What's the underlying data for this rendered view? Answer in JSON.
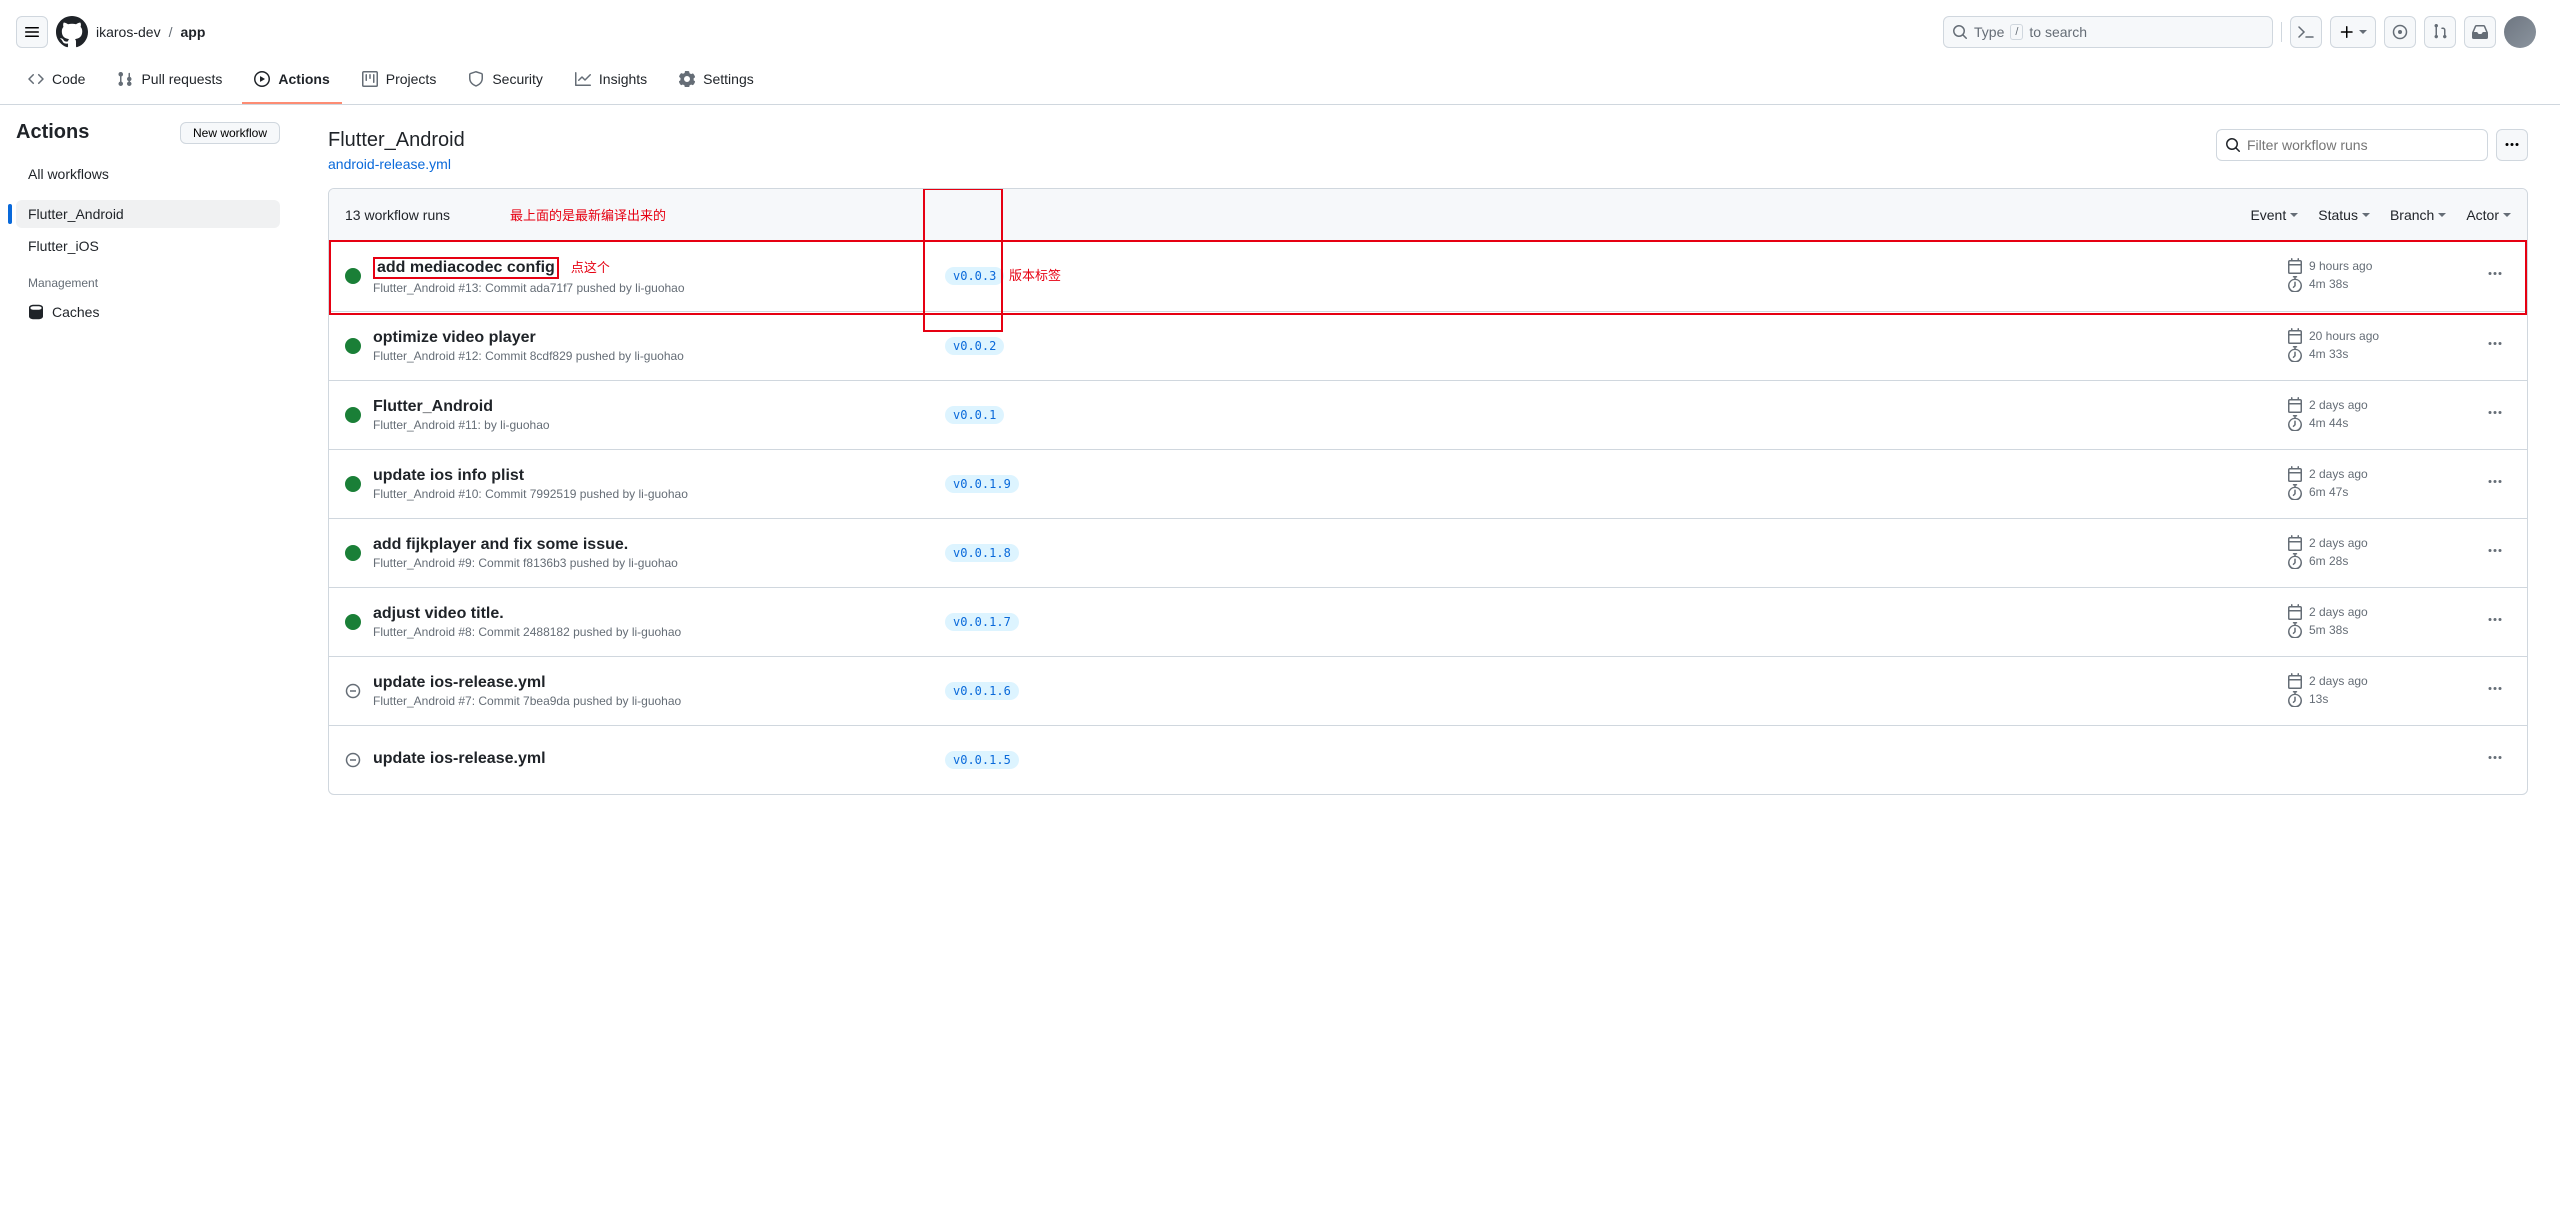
{
  "header": {
    "owner": "ikaros-dev",
    "repo": "app",
    "search_hint_pre": "Type",
    "search_key": "/",
    "search_hint_post": "to search"
  },
  "nav": {
    "code": "Code",
    "pulls": "Pull requests",
    "actions": "Actions",
    "projects": "Projects",
    "security": "Security",
    "insights": "Insights",
    "settings": "Settings"
  },
  "sidebar": {
    "title": "Actions",
    "new_workflow": "New workflow",
    "all": "All workflows",
    "wf1": "Flutter_Android",
    "wf2": "Flutter_iOS",
    "management": "Management",
    "caches": "Caches"
  },
  "content": {
    "title": "Flutter_Android",
    "file": "android-release.yml",
    "filter_placeholder": "Filter workflow runs",
    "runs_count": "13 workflow runs",
    "filters": {
      "event": "Event",
      "status": "Status",
      "branch": "Branch",
      "actor": "Actor"
    }
  },
  "annotations": {
    "top": "最上面的是最新编译出来的",
    "click": "点这个",
    "version": "版本标签"
  },
  "runs": [
    {
      "status": "success",
      "title": "add mediacodec config",
      "sub": "Flutter_Android #13: Commit ada71f7 pushed by li-guohao",
      "tag": "v0.0.3",
      "time": "9 hours ago",
      "dur": "4m 38s"
    },
    {
      "status": "success",
      "title": "optimize video player",
      "sub": "Flutter_Android #12: Commit 8cdf829 pushed by li-guohao",
      "tag": "v0.0.2",
      "time": "20 hours ago",
      "dur": "4m 33s"
    },
    {
      "status": "success",
      "title": "Flutter_Android",
      "sub": "Flutter_Android #11: by li-guohao",
      "tag": "v0.0.1",
      "time": "2 days ago",
      "dur": "4m 44s"
    },
    {
      "status": "success",
      "title": "update ios info plist",
      "sub": "Flutter_Android #10: Commit 7992519 pushed by li-guohao",
      "tag": "v0.0.1.9",
      "time": "2 days ago",
      "dur": "6m 47s"
    },
    {
      "status": "success",
      "title": "add fijkplayer and fix some issue.",
      "sub": "Flutter_Android #9: Commit f8136b3 pushed by li-guohao",
      "tag": "v0.0.1.8",
      "time": "2 days ago",
      "dur": "6m 28s"
    },
    {
      "status": "success",
      "title": "adjust video title.",
      "sub": "Flutter_Android #8: Commit 2488182 pushed by li-guohao",
      "tag": "v0.0.1.7",
      "time": "2 days ago",
      "dur": "5m 38s"
    },
    {
      "status": "neutral",
      "title": "update ios-release.yml",
      "sub": "Flutter_Android #7: Commit 7bea9da pushed by li-guohao",
      "tag": "v0.0.1.6",
      "time": "2 days ago",
      "dur": "13s"
    },
    {
      "status": "neutral",
      "title": "update ios-release.yml",
      "sub": "",
      "tag": "v0.0.1.5",
      "time": "",
      "dur": ""
    }
  ]
}
